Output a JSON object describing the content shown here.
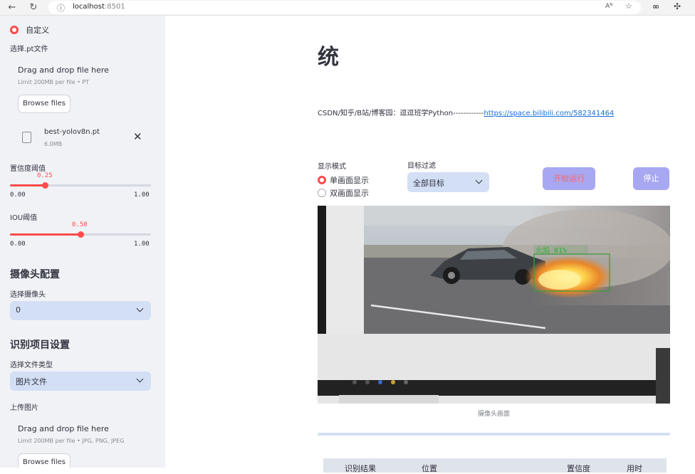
{
  "browser": {
    "url_host": "localhost",
    "url_port": ":8501",
    "read_aloud": "Aᴺ"
  },
  "sidebar": {
    "model_radio_label": "自定义",
    "pt_file_label": "选择.pt文件",
    "pt_dropzone": {
      "title": "Drag and drop file here",
      "limit": "Limit 200MB per file • PT",
      "browse_label": "Browse files"
    },
    "uploaded_file": {
      "name": "best-yolov8n.pt",
      "size": "6.0MB"
    },
    "confidence": {
      "label": "置信度阈值",
      "value": "0.25",
      "value_num": 0.25,
      "min": "0.00",
      "max": "1.00"
    },
    "iou": {
      "label": "IOU阈值",
      "value": "0.50",
      "value_num": 0.5,
      "min": "0.00",
      "max": "1.00"
    },
    "camera_section": "摄像头配置",
    "camera_select_label": "选择摄像头",
    "camera_value": "0",
    "recognition_section": "识别项目设置",
    "file_type_label": "选择文件类型",
    "file_type_value": "图片文件",
    "upload_image_label": "上传图片",
    "image_dropzone": {
      "title": "Drag and drop file here",
      "limit": "Limit 200MB per file • JPG, PNG, JPEG",
      "browse_label": "Browse files"
    }
  },
  "main": {
    "title": "统",
    "info_text": "CSDN/知乎/B站/博客园：逗逗班学Python------------",
    "info_link": "https://space.bilibili.com/582341464",
    "display_mode_label": "显示模式",
    "display_options": [
      "单画面显示",
      "双画面显示"
    ],
    "display_selected": 0,
    "target_filter_label": "目标过滤",
    "target_filter_value": "全部目标",
    "start_button": "开始运行",
    "stop_button": "停止",
    "detection": {
      "label": "火焰",
      "confidence": "81%"
    },
    "video_caption": "摄像头画面",
    "table_headers": [
      "识别结果",
      "位置",
      "置信度",
      "用时"
    ]
  },
  "colors": {
    "accent": "#ff4b4b",
    "sidebar_bg": "#f0f2f6",
    "select_bg": "#d3dff5",
    "button_bg": "#a8a7f2",
    "link": "#1a6fd6",
    "detect_box": "#3a9d3a"
  }
}
